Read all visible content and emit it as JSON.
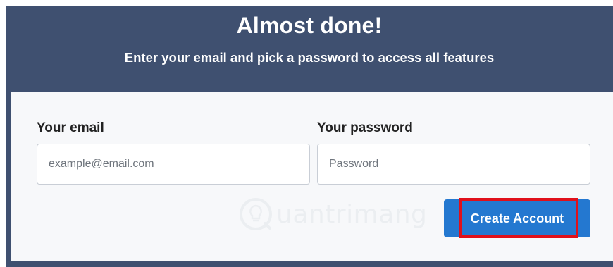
{
  "header": {
    "title": "Almost done!",
    "subtitle": "Enter your email and pick a password to access all features"
  },
  "form": {
    "email_label": "Your email",
    "email_placeholder": "example@email.com",
    "email_value": "",
    "password_label": "Your password",
    "password_placeholder": "Password",
    "password_value": "",
    "submit_label": "Create Account"
  },
  "watermark": {
    "text": "uantrimang",
    "icon": "quantrimang-logo-icon"
  },
  "colors": {
    "header_bg": "#3f5070",
    "card_bg": "#f7f8fa",
    "button_bg": "#2478d0",
    "highlight": "#e0101a"
  }
}
